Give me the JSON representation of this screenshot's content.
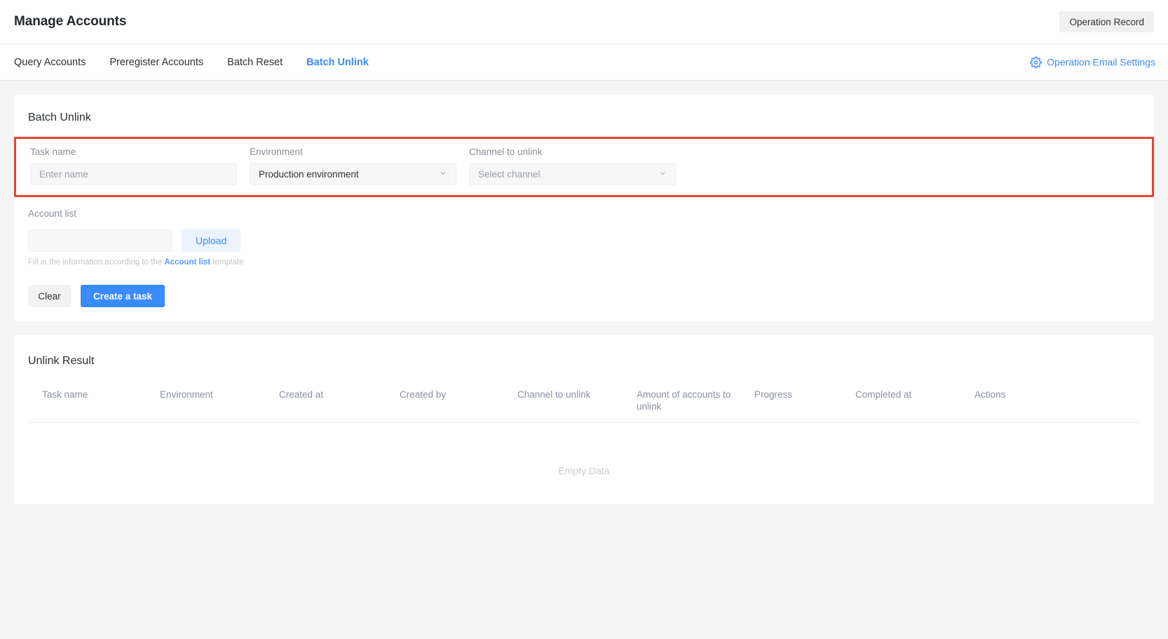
{
  "header": {
    "title": "Manage Accounts",
    "operation_record_label": "Operation Record"
  },
  "tabs": [
    {
      "label": "Query Accounts",
      "active": false
    },
    {
      "label": "Preregister Accounts",
      "active": false
    },
    {
      "label": "Batch Reset",
      "active": false
    },
    {
      "label": "Batch Unlink",
      "active": true
    }
  ],
  "email_settings": {
    "icon": "gear-icon",
    "label": "Operation Email Settings"
  },
  "form": {
    "card_title": "Batch Unlink",
    "highlight_color": "#ea4335",
    "task_name": {
      "label": "Task name",
      "placeholder": "Enter name",
      "value": ""
    },
    "environment": {
      "label": "Environment",
      "value": "Production environment",
      "options": [
        "Production environment"
      ]
    },
    "channel": {
      "label": "Channel to unlink",
      "placeholder": "Select channel",
      "value": ""
    },
    "account_list": {
      "label": "Account list",
      "file_value": "",
      "upload_label": "Upload",
      "hint_prefix": "Fill in the information according to the ",
      "hint_link": "Account list",
      "hint_suffix": " template"
    },
    "clear_label": "Clear",
    "create_label": "Create a task"
  },
  "result": {
    "title": "Unlink Result",
    "columns": [
      "Task name",
      "Environment",
      "Created at",
      "Created by",
      "Channel to unlink",
      "Amount of accounts to unlink",
      "Progress",
      "Completed at",
      "Actions"
    ],
    "rows": [],
    "empty_text": "Empty Data"
  },
  "colors": {
    "accent": "#3a8bfd",
    "highlight": "#ea4335",
    "page_bg": "#f5f5f5"
  }
}
